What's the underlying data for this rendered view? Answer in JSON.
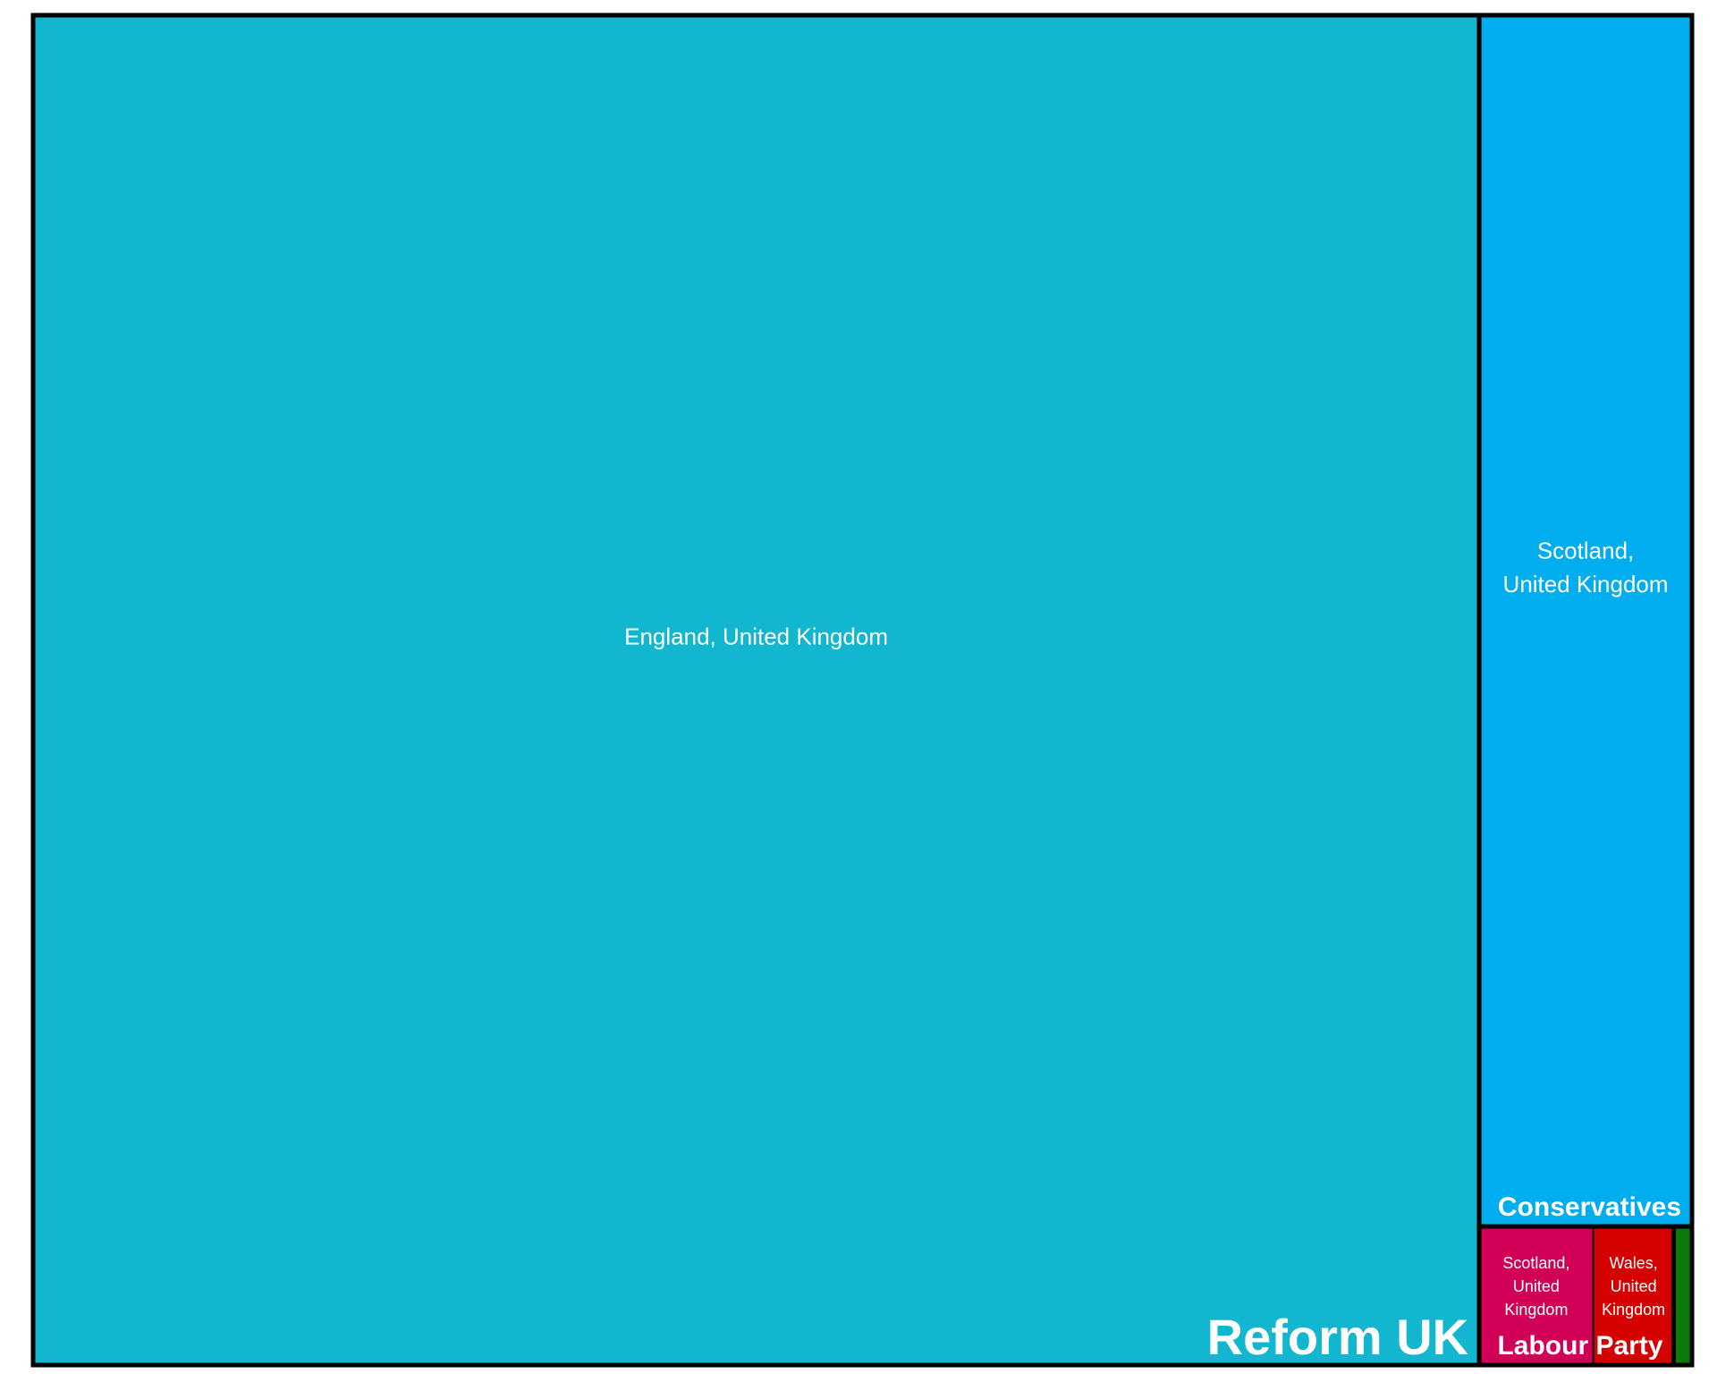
{
  "chart_data": {
    "type": "treemap",
    "title": "",
    "groups": [
      {
        "name": "Reform UK",
        "color": "#12B6CF",
        "children": [
          {
            "name": "England, United Kingdom",
            "value": 1000,
            "color": "#12B6CF"
          }
        ]
      },
      {
        "name": "Conservatives",
        "color": "#00AEEF",
        "children": [
          {
            "name": "Scotland, United Kingdom",
            "value": 132,
            "color": "#00AEEF"
          }
        ]
      },
      {
        "name": "Labour Party",
        "color": "#D50000",
        "children": [
          {
            "name": "Scotland, United Kingdom",
            "value": 8.1,
            "color": "#D10056"
          },
          {
            "name": "Wales, United Kingdom",
            "value": 5.7,
            "color": "#D50000"
          }
        ]
      },
      {
        "name": "",
        "color": "#0A7A0A",
        "children": [
          {
            "name": "",
            "value": 1.3,
            "color": "#0A7A0A"
          }
        ]
      }
    ]
  }
}
